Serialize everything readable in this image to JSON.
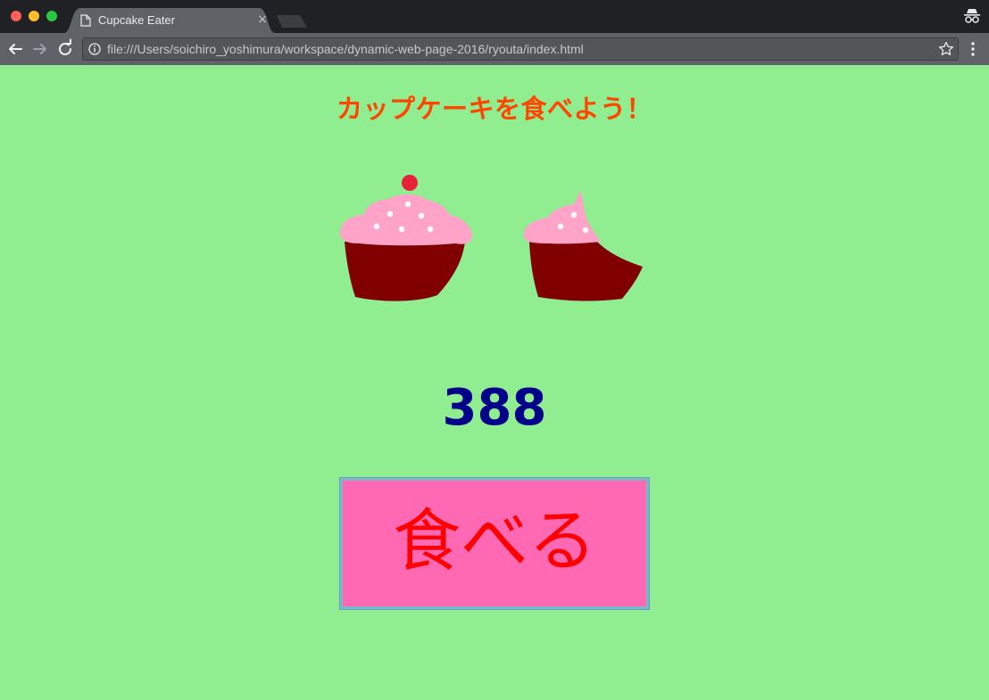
{
  "browser": {
    "tab": {
      "title": "Cupcake Eater",
      "close_glyph": "×"
    },
    "address_bar": {
      "url": "file:///Users/soichiro_yoshimura/workspace/dynamic-web-page-2016/ryouta/index.html"
    },
    "icons": [
      "close-window",
      "minimize-window",
      "zoom-window",
      "document-icon",
      "new-tab",
      "incognito-icon",
      "back-arrow-icon",
      "forward-arrow-icon",
      "reload-icon",
      "info-icon",
      "star-icon",
      "menu-icon"
    ]
  },
  "page": {
    "title": "カップケーキを食べよう！",
    "counter": "388",
    "eat_button_label": "食べる",
    "colors": {
      "background": "#90ee90",
      "title": "#ff4500",
      "counter": "#00008b",
      "button_bg": "#ff69b4",
      "button_text": "#ff0000",
      "frosting": "#ffa3c8",
      "cake": "#800000",
      "cherry": "#e8213a"
    },
    "images": [
      "cupcake-full",
      "cupcake-bitten"
    ]
  }
}
